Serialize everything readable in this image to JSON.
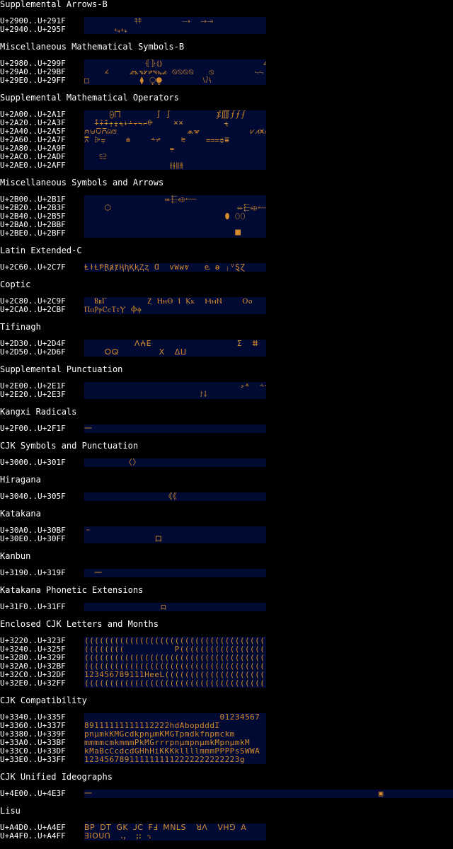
{
  "colors": {
    "background": "#000000",
    "label_text": "#ffffff",
    "band_fill": "#000a33",
    "glyph_text": "#d4892b"
  },
  "sections": [
    {
      "title": "Supplemental Arrows-B",
      "rows": [
        {
          "range": "U+2900..U+291F",
          "glyphs": "          ⤉⤉        ⤏  ⤑⤑"
        },
        {
          "range": "U+2940..U+295F",
          "glyphs": "      ⥆⥆"
        }
      ]
    },
    {
      "title": "Miscellaneous Mathematical Symbols-B",
      "rows": [
        {
          "range": "U+2980..U+299F",
          "glyphs": "            ⦃⦄⦅⦆                    ∠"
        },
        {
          "range": "U+29A0..U+29BF",
          "glyphs": "    ∠    ⦨⦩⦪⦫⦬⦭⦮⦯ ⦰⦰⦰⦰   ⦸        ⨫⨫"
        },
        {
          "range": "U+29E0..U+29FF",
          "glyphs": "□          ⧫ ⧬⧭        ⧵⧶⧷"
        }
      ]
    },
    {
      "title": "Supplemental Mathematical Operators",
      "rows": [
        {
          "range": "U+2A00..U+2A1F",
          "glyphs": "     ⨀⨅       ∫ ∫         ⨋⨌⨍⨎⨏"
        },
        {
          "range": "U+2A20..U+2A3F",
          "glyphs": "  ⨢⨣⨤⨥⨦⨧⨨⨩⨪⨫⨬⨭    ⨯⨯        ⨧"
        },
        {
          "range": "U+2A40..U+2A5F",
          "glyphs": "⩀⩁⩂⩃⩄⩅              ⩕⩖          ⩗⩘⩙⩚⩛⩜"
        },
        {
          "range": "U+2A60..U+2A7F",
          "glyphs": "⩞ ⩥⩦    ⩧    ⩪⩫    ⩬    ⩶⩷⩸"
        },
        {
          "range": "U+2A80..U+2A9F",
          "glyphs": "                 ⩦"
        },
        {
          "range": "U+2AC0..U+2ADF",
          "glyphs": "   ⫅⫆"
        },
        {
          "range": "U+2AE0..U+2AFF",
          "glyphs": "                 ⫲⫳⫴⫵"
        }
      ]
    },
    {
      "title": "Miscellaneous Symbols and Arrows",
      "rows": [
        {
          "range": "U+2B00..U+2B1F",
          "glyphs": "                ⬰⬱⬲⬳                ⬜⬜"
        },
        {
          "range": "U+2B20..U+2B3F",
          "glyphs": "    ⬡                         ⬰⬱⬲⬳"
        },
        {
          "range": "U+2B40..U+2B5F",
          "glyphs": "                            ⬮ ⬯⬯"
        },
        {
          "range": "U+2BA0..U+2BBF",
          "glyphs": "                                     ⬝"
        },
        {
          "range": "U+2BE0..U+2BFF",
          "glyphs": "                              ⯀"
        }
      ]
    },
    {
      "title": "Latin Extended-C",
      "rows": [
        {
          "range": "U+2C60..U+2C7F",
          "glyphs": "ⱠⱡⱢⱣⱤⱥⱦⱧⱨⱩⱪⱫⱬ Ɑ  ⱱⱲⱳⱴ   ⱸ ⱺ ⱼⱽⱾⱿ"
        }
      ]
    },
    {
      "title": "Coptic",
      "rows": [
        {
          "range": "U+2C80..U+2C9F",
          "glyphs": "  ⲂⲃⲄ        Ⲍ ⲎⲏⲐ Ⲓ Ⲕⲕ  ⲘⲙⲚ    Ⲟⲟ"
        },
        {
          "range": "U+2CA0..U+2CBF",
          "glyphs": "ⲠⲡⲢⲣⲤⲥⲦⲧⲨ Ⲫⲫ"
        }
      ]
    },
    {
      "title": "Tifinagh",
      "rows": [
        {
          "range": "U+2D30..U+2D4F",
          "glyphs": "          ⴷⵄⴹ                 ⵉ  ⵌ"
        },
        {
          "range": "U+2D50..U+2D6F",
          "glyphs": "    ⵔⵕ        ⵝ  ⵠⵡ"
        }
      ]
    },
    {
      "title": "Supplemental Punctuation",
      "rows": [
        {
          "range": "U+2E00..U+2E1F",
          "glyphs": "                               ⸗⸛  ⸞⸞⸟"
        },
        {
          "range": "U+2E20..U+2E3F",
          "glyphs": "                       ⸷⸸"
        }
      ]
    },
    {
      "title": "Kangxi Radicals",
      "rows": [
        {
          "range": "U+2F00..U+2F1F",
          "glyphs": "⼀"
        }
      ]
    },
    {
      "title": "CJK Symbols and Punctuation",
      "rows": [
        {
          "range": "U+3000..U+301F",
          "glyphs": "        〈〉"
        }
      ]
    },
    {
      "title": "Hiragana",
      "rows": [
        {
          "range": "U+3040..U+305F",
          "glyphs": "                《《"
        }
      ]
    },
    {
      "title": "Katakana",
      "rows": [
        {
          "range": "U+30A0..U+30BF",
          "glyphs": "゠"
        },
        {
          "range": "U+30E0..U+30FF",
          "glyphs": "              ロ                     ・"
        }
      ]
    },
    {
      "title": "Kanbun",
      "rows": [
        {
          "range": "U+3190..U+319F",
          "glyphs": "  ㆒"
        }
      ]
    },
    {
      "title": "Katakana Phonetic Extensions",
      "rows": [
        {
          "range": "U+31F0..U+31FF",
          "glyphs": "               ㇿ"
        }
      ]
    },
    {
      "title": "Enclosed CJK Letters and Months",
      "rows": [
        {
          "range": "U+3220..U+323F",
          "glyphs": "((((((((((((((((((((((((((((((((((((("
        },
        {
          "range": "U+3240..U+325F",
          "glyphs": "((((((((          P((((((((((((((((("
        },
        {
          "range": "U+3280..U+329F",
          "glyphs": "((((((((((((((((((((((((((((((((((((("
        },
        {
          "range": "U+32A0..U+32BF",
          "glyphs": "((((((((((((((((((((((((((((((((((((("
        },
        {
          "range": "U+32C0..U+32DF",
          "glyphs": "123456789111HeeL(((((((((((((((((((("
        },
        {
          "range": "U+32E0..U+32FF",
          "glyphs": "(((((((((((((((((((((((((((((((((((("
        }
      ]
    },
    {
      "title": "CJK Compatibility",
      "rows": [
        {
          "range": "U+3340..U+335F",
          "glyphs": "                           01234567"
        },
        {
          "range": "U+3360..U+337F",
          "glyphs": "89111111111112222hdAbopdddI"
        },
        {
          "range": "U+3380..U+339F",
          "glyphs": "pnµmkKMGcdkpnµmKMGTpmdkfnpmckm"
        },
        {
          "range": "U+33A0..U+33BF",
          "glyphs": "mmmmcmkmmmPkMGrrrpnµmpnµmkMpnµmkM"
        },
        {
          "range": "U+33C0..U+33DF",
          "glyphs": "kMaBcCcdcdGHhHiKKKkllllmmmPPPPsSWWA"
        },
        {
          "range": "U+33E0..U+33FF",
          "glyphs": "1234567891111111112222222222223g"
        }
      ]
    },
    {
      "title": "CJK Unified Ideographs",
      "wide": true,
      "rows": [
        {
          "range": "U+4E00..U+4E3F",
          "glyphs": "一                                                         ▣"
        }
      ]
    },
    {
      "title": "Lisu",
      "rows": [
        {
          "range": "U+A4D0..U+A4EF",
          "glyphs": "ꓐꓑ ꓓꓔ ꓖꓗ ꓙꓚ ꓝꓞ ꓟꓠꓡꓢ  ꓤꓥ  ꓦꓧꓨ ꓮ"
        },
        {
          "range": "U+A4F0..U+A4FF",
          "glyphs": "ꓱꓲꓳꓴꓵ  ꓸꓹ  ꓼꓽ ꓾"
        }
      ]
    }
  ]
}
